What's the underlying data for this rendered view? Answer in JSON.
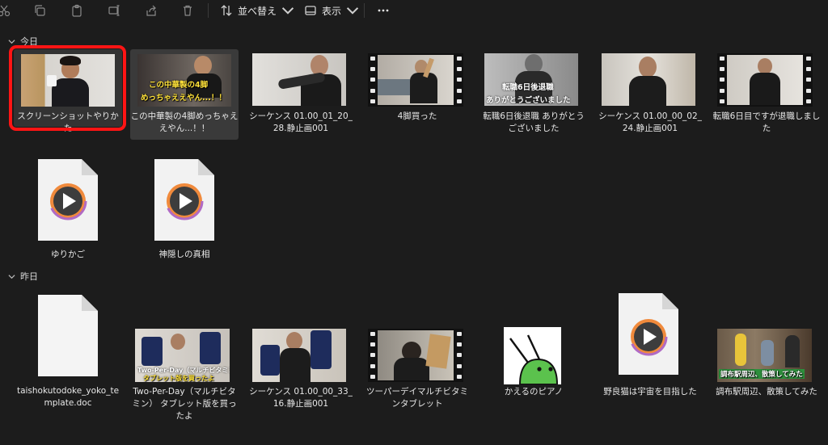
{
  "toolbar": {
    "icons": [
      "cut-icon",
      "copy-icon",
      "paste-icon",
      "rename-icon",
      "share-icon",
      "delete-icon"
    ],
    "sort_label": "並べ替え",
    "view_label": "表示",
    "more_icon": "more-icon"
  },
  "groups": {
    "today": "今日",
    "yesterday": "昨日"
  },
  "today_items": [
    {
      "name": "スクリーンショットやりかた",
      "kind": "video-thumb"
    },
    {
      "name": "この中華製の4脚めっちゃええやん...！！",
      "kind": "video-thumb",
      "caption1": "この中華製の4脚",
      "caption2": "めっちゃええやん...！！"
    },
    {
      "name": "シーケンス 01.00_01_20_28.静止画001",
      "kind": "image-thumb"
    },
    {
      "name": "4脚買った",
      "kind": "film-thumb"
    },
    {
      "name": "転職6日後退職 ありがとうございました",
      "kind": "image-thumb",
      "caption1": "転職6日後退職",
      "caption2": "ありがとうございました"
    },
    {
      "name": "シーケンス 01.00_00_02_24.静止画001",
      "kind": "image-thumb"
    },
    {
      "name": "転職6日目ですが退職しました",
      "kind": "film-thumb"
    },
    {
      "name": "ゆりかご",
      "kind": "media-file"
    },
    {
      "name": "神隠しの真相",
      "kind": "media-file"
    }
  ],
  "yesterday_items": [
    {
      "name": "taishokutodoke_yoko_template.doc",
      "kind": "blank-file"
    },
    {
      "name": "Two-Per-Day（マルチビタミン） タブレット版を買ったよ",
      "kind": "video-thumb",
      "caption1": "Two-Per-Day（マルチビタミン）",
      "caption2": "タブレット版を買ったよ"
    },
    {
      "name": "シーケンス 01.00_00_33_16.静止画001",
      "kind": "image-thumb"
    },
    {
      "name": "ツーパーデイマルチビタミンタブレット",
      "kind": "film-thumb"
    },
    {
      "name": "かえるのピアノ",
      "kind": "image-thumb"
    },
    {
      "name": "野良猫は宇宙を目指した",
      "kind": "media-file"
    },
    {
      "name": "調布駅周辺、散策してみた",
      "kind": "video-thumb",
      "caption1": "調布駅周辺、散策してみた"
    }
  ],
  "colors": {
    "background": "#1c1c1c",
    "selection": "#3a3a3a",
    "highlight": "#ff1414",
    "caption_yellow": "#ffe23a"
  }
}
